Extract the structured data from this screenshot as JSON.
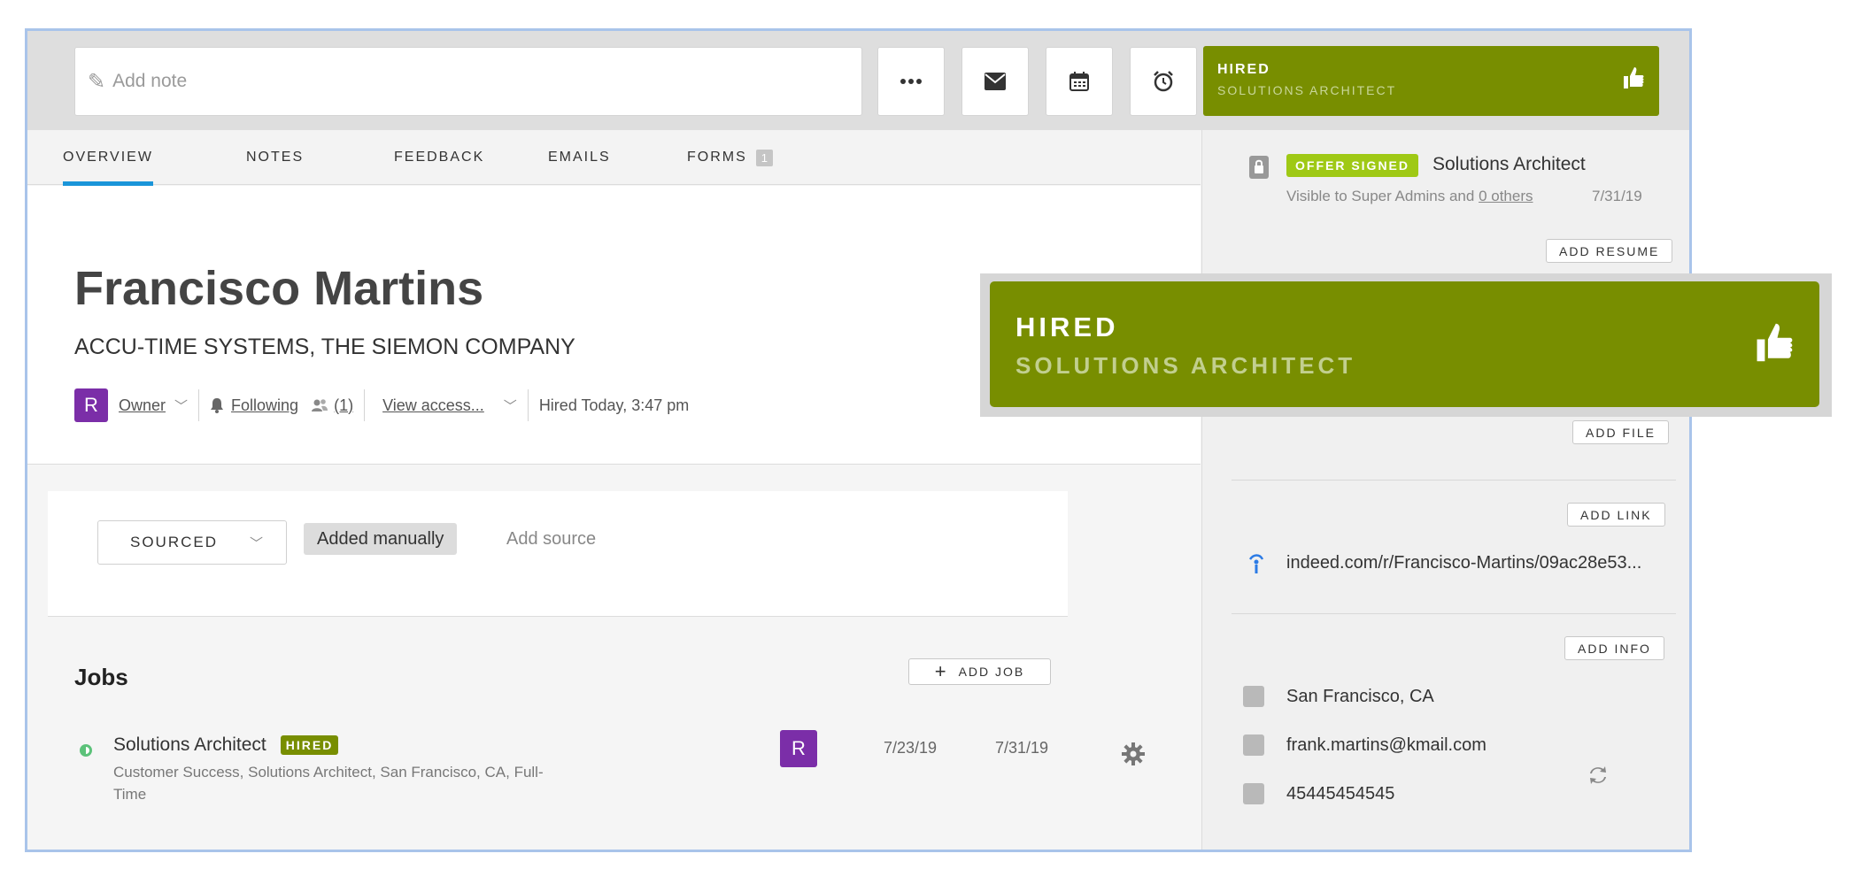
{
  "note": {
    "placeholder": "Add note"
  },
  "status_top": {
    "label": "HIRED",
    "job": "SOLUTIONS ARCHITECT"
  },
  "tabs": [
    {
      "label": "OVERVIEW"
    },
    {
      "label": "NOTES"
    },
    {
      "label": "FEEDBACK"
    },
    {
      "label": "EMAILS"
    },
    {
      "label": "FORMS",
      "count": "1"
    }
  ],
  "profile": {
    "name": "Francisco Martins",
    "company": "ACCU-TIME SYSTEMS, THE SIEMON COMPANY",
    "owner_initial": "R",
    "owner_label": "Owner",
    "following_label": "Following",
    "followers_count": "(1)",
    "view_access": "View access...",
    "hired_text": "Hired Today, 3:47 pm"
  },
  "source": {
    "stage": "SOURCED",
    "tag": "Added manually",
    "add_source": "Add source"
  },
  "jobs": {
    "title": "Jobs",
    "add_button": "ADD JOB",
    "items": [
      {
        "title": "Solutions Architect",
        "badge": "HIRED",
        "desc": "Customer Success, Solutions Architect, San Francisco, CA, Full-Time",
        "owner_initial": "R",
        "date1": "7/23/19",
        "date2": "7/31/19"
      }
    ]
  },
  "right_panel": {
    "offer_badge": "OFFER SIGNED",
    "offer_title": "Solutions Architect",
    "visibility_prefix": "Visible to Super Admins and",
    "visibility_link": "0 others",
    "offer_date": "7/31/19",
    "add_resume": "ADD RESUME",
    "add_file": "ADD FILE",
    "add_link": "ADD LINK",
    "link_url": "indeed.com/r/Francisco-Martins/09ac28e53...",
    "add_info": "ADD INFO",
    "location": "San Francisco, CA",
    "email": "frank.martins@kmail.com",
    "phone": "45445454545"
  },
  "overlay": {
    "label": "HIRED",
    "job": "SOLUTIONS ARCHITECT"
  },
  "colors": {
    "hired_green": "#788e00",
    "offer_green": "#9fc915",
    "tab_accent": "#1a95d9",
    "avatar_purple": "#7b2ea8"
  },
  "icons": [
    "pencil-icon",
    "more-icon",
    "mail-icon",
    "calendar-icon",
    "alarm-icon",
    "thumbs-up-icon",
    "bell-icon",
    "people-icon",
    "gear-icon",
    "lock-icon",
    "link-icon",
    "home-icon",
    "email-icon",
    "phone-icon",
    "sync-icon"
  ]
}
